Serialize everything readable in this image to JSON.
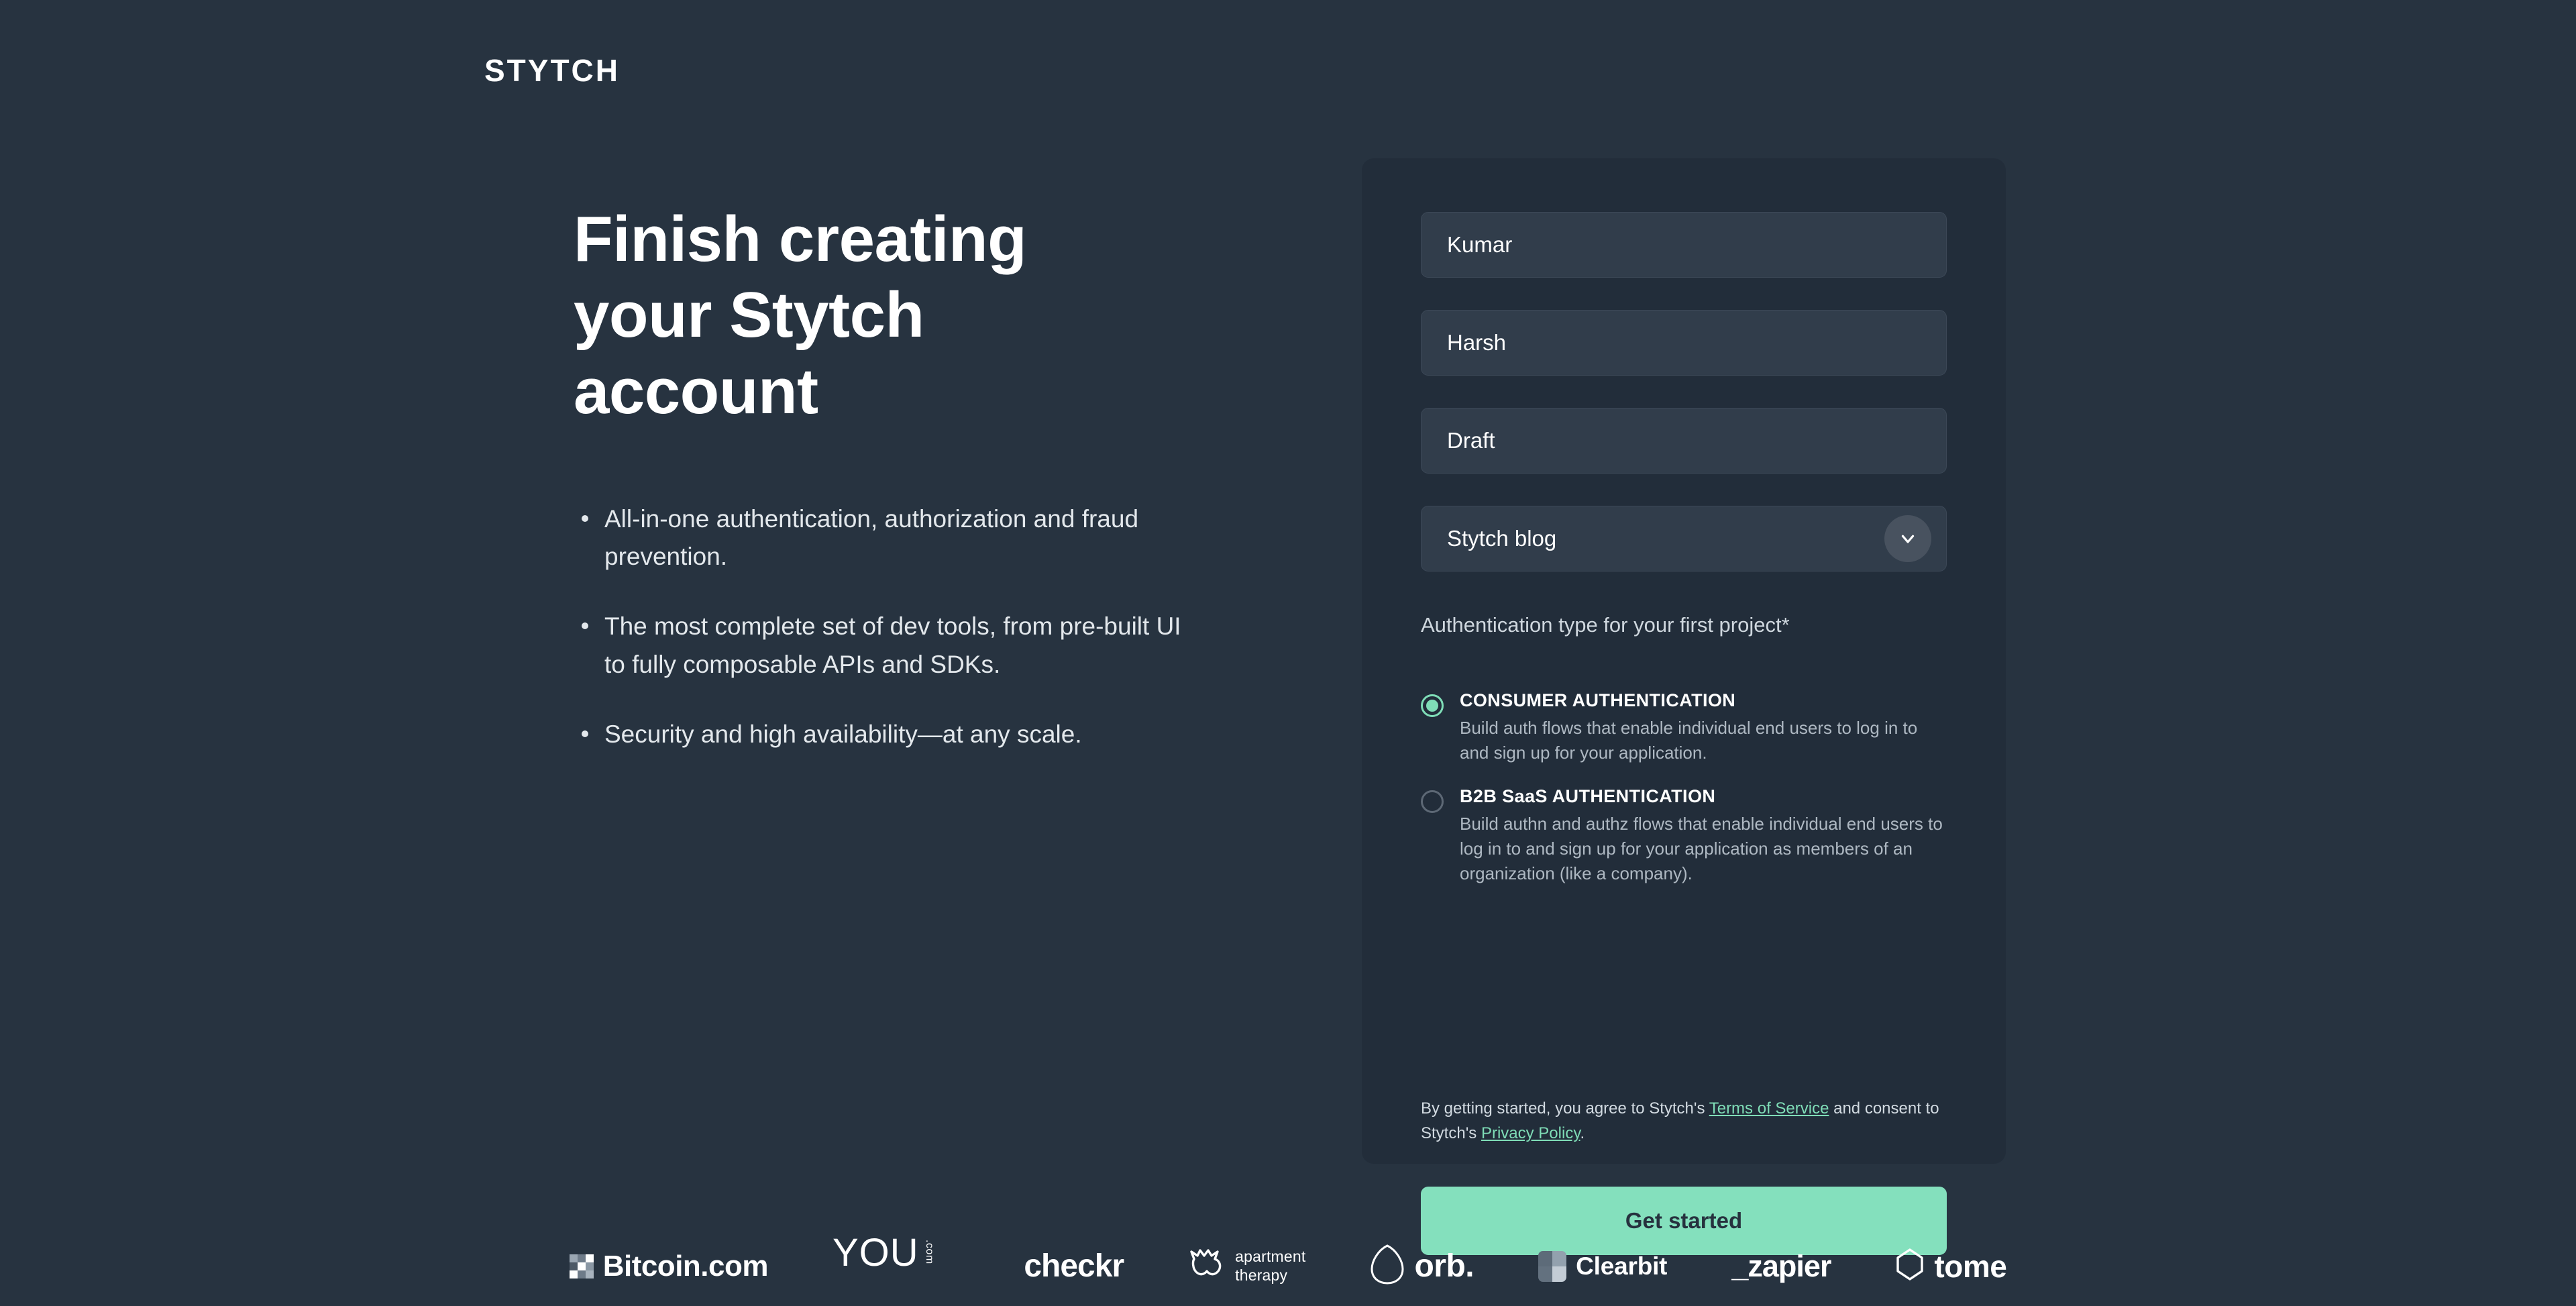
{
  "brand": {
    "name": "STYTCH"
  },
  "hero": {
    "headline": "Finish creating\nyour Stytch\naccount",
    "bullets": [
      "All-in-one authentication, authorization and fraud prevention.",
      "The most complete set of dev tools, from pre-built UI to fully composable APIs and SDKs.",
      "Security and high availability—at any scale."
    ]
  },
  "form": {
    "fields": [
      {
        "name": "first-name",
        "value": "Kumar",
        "placeholder": "First name"
      },
      {
        "name": "last-name",
        "value": "Harsh",
        "placeholder": "Last name"
      },
      {
        "name": "company",
        "value": "Draft",
        "placeholder": "Company"
      }
    ],
    "referral": {
      "value": "Stytch blog",
      "placeholder": "How did you hear about us?",
      "icon": "chevron-down-icon"
    },
    "auth_label": "Authentication type for your first project*",
    "auth_options": [
      {
        "id": "consumer",
        "title": "CONSUMER AUTHENTICATION",
        "description": "Build auth flows that enable individual end users to log in to and sign up for your application.",
        "selected": true
      },
      {
        "id": "b2b",
        "title": "B2B SaaS AUTHENTICATION",
        "description": "Build authn and authz flows that enable individual end users to log in to and sign up for your application as members of an organization (like a company).",
        "selected": false
      }
    ],
    "legal": {
      "prefix": "By getting started, you agree to Stytch's",
      "terms_link": "Terms of Service",
      "middle": "and consent to Stytch's",
      "privacy_link": "Privacy Policy",
      "suffix": "."
    },
    "submit_label": "Get started"
  },
  "logos": [
    {
      "name": "bitcoin-com-logo",
      "label": "Bitcoin.com"
    },
    {
      "name": "you-com-logo",
      "label": "YOU",
      "sup": ".com"
    },
    {
      "name": "checkr-logo",
      "label": "checkr"
    },
    {
      "name": "apartment-therapy-logo",
      "line1": "apartment",
      "line2": "therapy"
    },
    {
      "name": "orb-logo",
      "label": "orb."
    },
    {
      "name": "clearbit-logo",
      "label": "Clearbit"
    },
    {
      "name": "zapier-logo",
      "label": "_zapier"
    },
    {
      "name": "tome-logo",
      "label": "tome"
    }
  ],
  "colors": {
    "page_bg": "#273340",
    "card_bg": "#222d3a",
    "input_bg": "#313d4b",
    "accent_green": "#84e0bd",
    "link_green": "#7fddb7",
    "text_primary": "#ffffff",
    "text_muted": "#aeb8c2"
  }
}
